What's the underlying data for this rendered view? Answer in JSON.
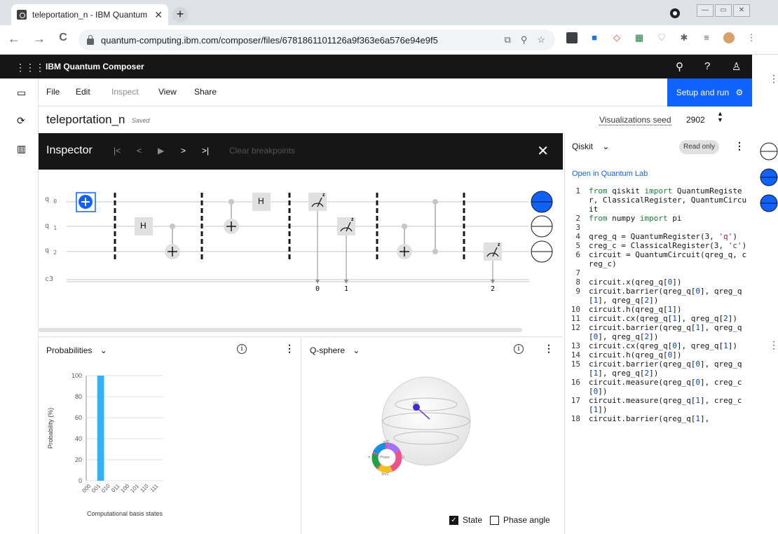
{
  "browser": {
    "tab_title": "teleportation_n - IBM Quantum",
    "tab_close": "✕",
    "new_tab": "+",
    "url": "quantum-computing.ibm.com/composer/files/6781861101126a9f363e6a576e94e9f5",
    "back": "←",
    "forward": "→",
    "reload": "C",
    "window_controls": [
      "—",
      "▭",
      "✕"
    ]
  },
  "app": {
    "title": "IBM Quantum Composer",
    "menu": [
      "File",
      "Edit",
      "Inspect",
      "View",
      "Share"
    ],
    "setup_button": "Setup and run",
    "file_name": "teleportation_n",
    "saved_status": "Saved",
    "vis_seed_label": "Visualizations seed",
    "vis_seed_value": "2902"
  },
  "inspector": {
    "title": "Inspector",
    "controls": [
      "|<",
      "<",
      "▶",
      ">",
      ">|"
    ],
    "clear_breakpoints": "Clear breakpoints",
    "close": "✕"
  },
  "circuit": {
    "qubits": [
      {
        "label": "q",
        "index": "0"
      },
      {
        "label": "q",
        "index": "1"
      },
      {
        "label": "q",
        "index": "2"
      }
    ],
    "classical_label": "c3",
    "gate_h": "H",
    "measure_z": "z",
    "cbit_indices": [
      "0",
      "1",
      "2"
    ]
  },
  "probabilities": {
    "title": "Probabilities",
    "info": "i",
    "more": "⋮",
    "chart_data": {
      "type": "bar",
      "categories": [
        "000",
        "001",
        "010",
        "011",
        "100",
        "101",
        "110",
        "111"
      ],
      "values": [
        0,
        100,
        0,
        0,
        0,
        0,
        0,
        0
      ],
      "xlabel": "Computational basis states",
      "ylabel": "Probability (%)",
      "ylim": [
        0,
        100
      ],
      "yticks": [
        "0",
        "20",
        "40",
        "60",
        "80",
        "100"
      ],
      "bar_color": "#33b1ff"
    }
  },
  "qsphere": {
    "title": "Q-sphere",
    "info": "i",
    "more": "⋮",
    "state_label": "State",
    "state_checked": true,
    "phase_label": "Phase angle",
    "phase_checked": false,
    "wheel_center": "Phase",
    "wheel_top": "π/2",
    "wheel_left": "π",
    "wheel_right": "0",
    "wheel_bottom": "3π/2",
    "point_label": "001"
  },
  "code": {
    "language": "Qiskit",
    "read_only": "Read only",
    "open_lab": "Open in Quantum Lab",
    "more": "⋮",
    "lines": [
      {
        "n": "1",
        "t": "from qiskit import QuantumRegister, ClassicalRegister, QuantumCircuit"
      },
      {
        "n": "2",
        "t": "from numpy import pi"
      },
      {
        "n": "3",
        "t": ""
      },
      {
        "n": "4",
        "t": "qreg_q = QuantumRegister(3, 'q')"
      },
      {
        "n": "5",
        "t": "creg_c = ClassicalRegister(3, 'c')"
      },
      {
        "n": "6",
        "t": "circuit = QuantumCircuit(qreg_q, creg_c)"
      },
      {
        "n": "7",
        "t": ""
      },
      {
        "n": "8",
        "t": "circuit.x(qreg_q[0])"
      },
      {
        "n": "9",
        "t": "circuit.barrier(qreg_q[0], qreg_q[1], qreg_q[2])"
      },
      {
        "n": "10",
        "t": "circuit.h(qreg_q[1])"
      },
      {
        "n": "11",
        "t": "circuit.cx(qreg_q[1], qreg_q[2])"
      },
      {
        "n": "12",
        "t": "circuit.barrier(qreg_q[1], qreg_q[0], qreg_q[2])"
      },
      {
        "n": "13",
        "t": "circuit.cx(qreg_q[0], qreg_q[1])"
      },
      {
        "n": "14",
        "t": "circuit.h(qreg_q[0])"
      },
      {
        "n": "15",
        "t": "circuit.barrier(qreg_q[0], qreg_q[1], qreg_q[2])"
      },
      {
        "n": "16",
        "t": "circuit.measure(qreg_q[0], creg_c[0])"
      },
      {
        "n": "17",
        "t": "circuit.measure(qreg_q[1], creg_c[1])"
      },
      {
        "n": "18",
        "t": "circuit.barrier(qreg_q[1],"
      }
    ]
  },
  "colors": {
    "accent": "#0f62fe",
    "header_bg": "#161616",
    "bloch_blue": "#0f62fe"
  }
}
